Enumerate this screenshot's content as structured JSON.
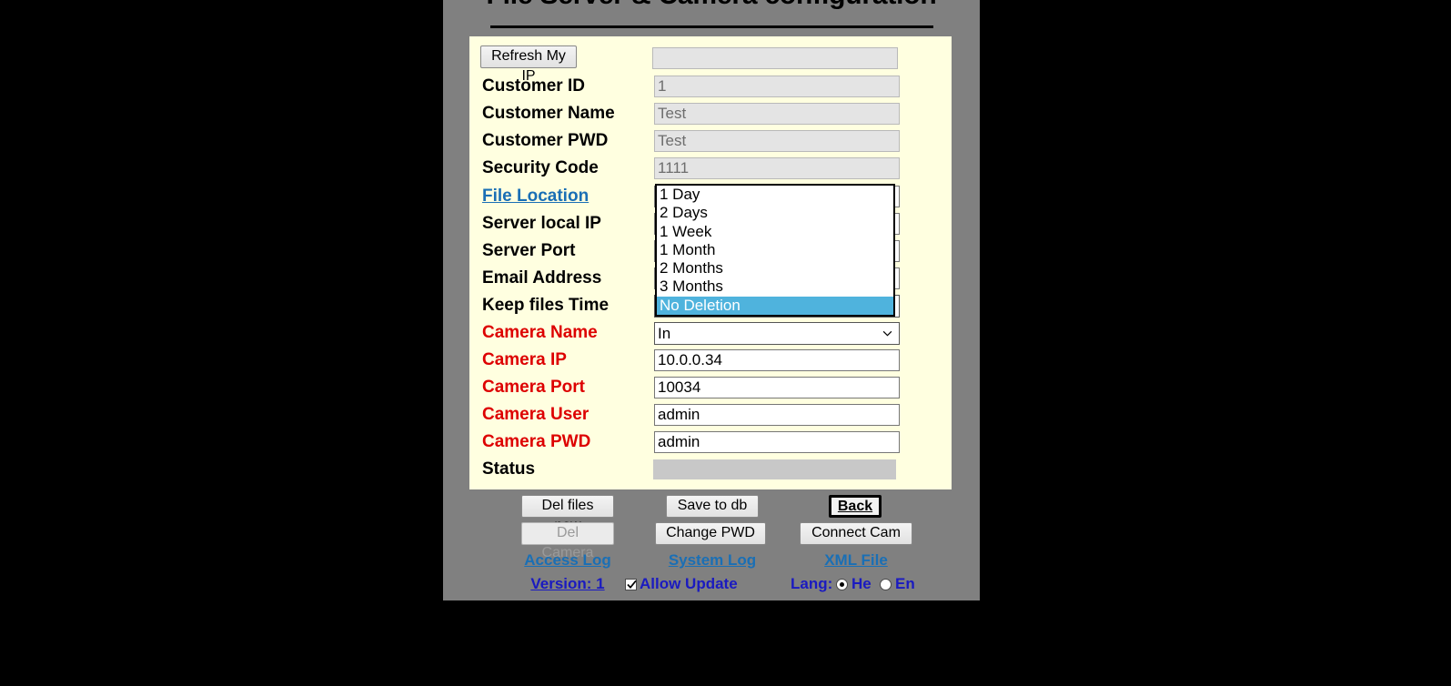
{
  "page": {
    "title": "File Server & Camera configuration",
    "background_color": "#000000",
    "container_color": "#808080",
    "panel_color": "#ffffe0",
    "accent_red": "#dd0000",
    "accent_link": "#1a6fb5",
    "accent_blue": "#1a1ac0",
    "highlight_color": "#4fb3dd"
  },
  "refresh_button": {
    "label": "Refresh My IP"
  },
  "fields": [
    {
      "label": "",
      "value": "",
      "placeholder": "",
      "state": "blank",
      "name": "my-ip"
    },
    {
      "label": "Customer ID",
      "value": "1",
      "state": "readonly",
      "name": "customer-id"
    },
    {
      "label": "Customer Name",
      "value": "Test",
      "state": "readonly",
      "name": "customer-name"
    },
    {
      "label": "Customer PWD",
      "value": "Test",
      "state": "readonly",
      "name": "customer-pwd"
    },
    {
      "label": "Security Code",
      "value": "1111",
      "state": "readonly",
      "name": "security-code"
    },
    {
      "label": "File Location",
      "value": "",
      "state": "editable",
      "name": "file-location",
      "label_style": "link"
    },
    {
      "label": "Server local IP",
      "value": "",
      "state": "editable",
      "name": "server-local-ip"
    },
    {
      "label": "Server Port",
      "value": "",
      "state": "editable",
      "name": "server-port"
    },
    {
      "label": "Email Address",
      "value": "",
      "state": "editable",
      "name": "email-address"
    },
    {
      "label": "Keep files Time",
      "value": "No Deletion",
      "state": "select",
      "name": "keep-files-time"
    },
    {
      "label": "Camera Name",
      "value": "In",
      "state": "select",
      "name": "camera-name",
      "label_style": "red"
    },
    {
      "label": "Camera IP",
      "value": "10.0.0.34",
      "state": "editable",
      "name": "camera-ip",
      "label_style": "red"
    },
    {
      "label": "Camera Port",
      "value": "10034",
      "state": "editable",
      "name": "camera-port",
      "label_style": "red"
    },
    {
      "label": "Camera User",
      "value": "admin",
      "state": "editable",
      "name": "camera-user",
      "label_style": "red"
    },
    {
      "label": "Camera PWD",
      "value": "admin",
      "state": "editable",
      "name": "camera-pwd",
      "label_style": "red"
    },
    {
      "label": "Status",
      "value": "",
      "state": "status",
      "name": "status"
    }
  ],
  "keep_files_dropdown": {
    "open": true,
    "options": [
      "1 Day",
      "2 Days",
      "1 Week",
      "1 Month",
      "2 Months",
      "3 Months",
      "No Deletion"
    ],
    "selected": "No Deletion",
    "selected_index": 6
  },
  "camera_name_options": [
    "In"
  ],
  "buttons": {
    "del_files_now": "Del files now",
    "save_to_db": "Save to db",
    "back": "Back",
    "del_camera": "Del Camera",
    "change_pwd": "Change PWD",
    "connect_cam": "Connect Cam"
  },
  "footer": {
    "access_log": "Access Log",
    "system_log": "System Log",
    "xml_file": "XML File",
    "version": "Version: 1",
    "allow_update": "Allow Update",
    "allow_update_checked": true,
    "lang_label": "Lang:",
    "lang_he": "He",
    "lang_en": "En",
    "lang_selected": "He"
  }
}
